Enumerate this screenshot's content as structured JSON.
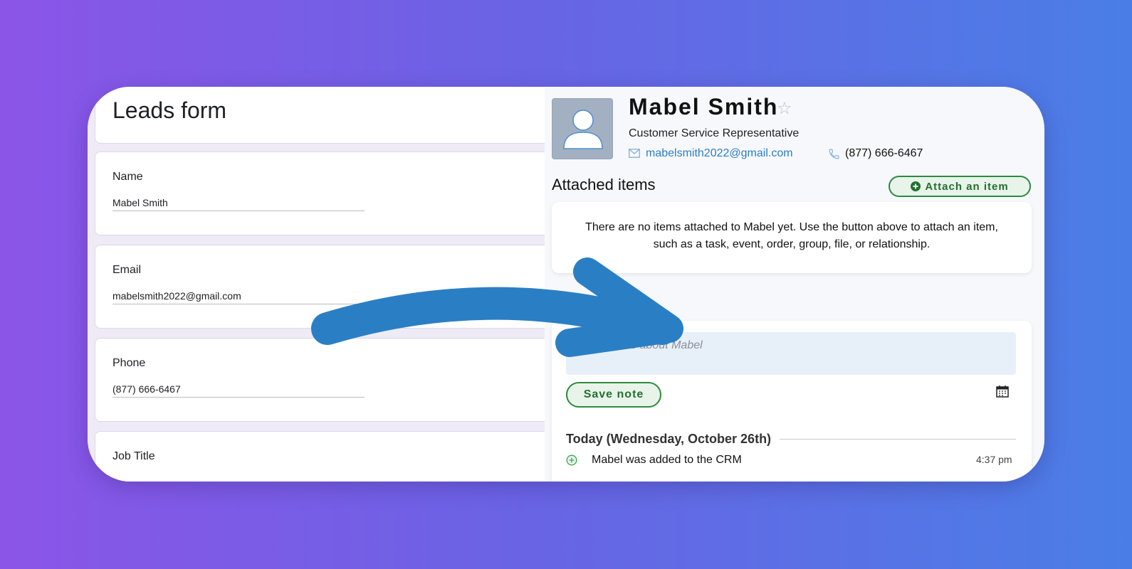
{
  "form": {
    "title": "Leads form",
    "fields": [
      {
        "label": "Name",
        "value": "Mabel Smith"
      },
      {
        "label": "Email",
        "value": "mabelsmith2022@gmail.com"
      },
      {
        "label": "Phone",
        "value": "(877) 666-6467"
      },
      {
        "label": "Job Title",
        "value": ""
      }
    ]
  },
  "contact": {
    "name": "Mabel Smith",
    "job_title": "Customer Service Representative",
    "email": "mabelsmith2022@gmail.com",
    "phone": "(877) 666-6467",
    "favorite_icon": "star-icon"
  },
  "attached": {
    "title": "Attached items",
    "button_label": "Attach an item",
    "empty_line1": "There are no items attached to Mabel yet. Use the button above to attach an item,",
    "empty_line2": "such as a task, event, order, group, file, or relationship."
  },
  "notes": {
    "placeholder": "Enter a note about Mabel",
    "save_label": "Save note",
    "day_heading": "Today (Wednesday, October 26th)",
    "activities": [
      {
        "text": "Mabel was added to the CRM",
        "time": "4:37 pm",
        "icon": "plus-circle-icon"
      }
    ]
  },
  "colors": {
    "accent_green": "#2d8a3f",
    "link_blue": "#2a7fc4",
    "arrow_blue": "#2a7fc4"
  }
}
